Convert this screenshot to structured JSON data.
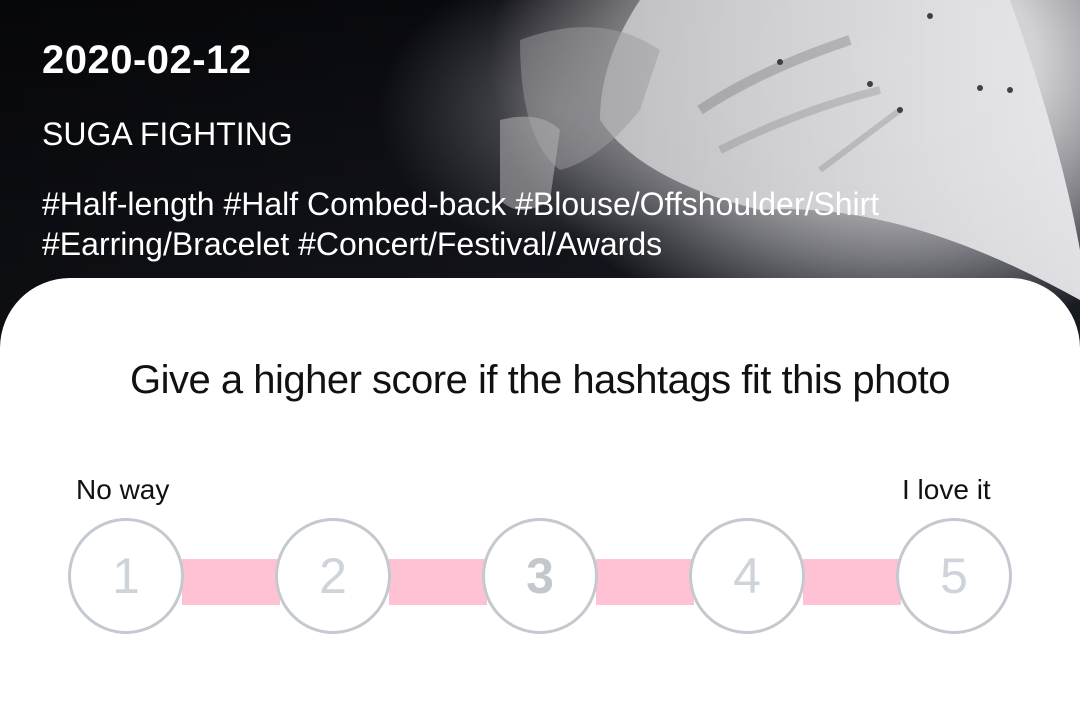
{
  "photo": {
    "date": "2020-02-12",
    "caption": "SUGA FIGHTING",
    "hashtags": [
      "#Half-length",
      "#Half Combed-back",
      "#Blouse/Offshoulder/Shirt",
      "#Earring/Bracelet",
      "#Concert/Festival/Awards"
    ]
  },
  "rating": {
    "prompt": "Give a higher score if the hashtags fit this photo",
    "low_label": "No way",
    "high_label": "I love it",
    "options": [
      "1",
      "2",
      "3",
      "4",
      "5"
    ],
    "connector_color": "#ffc2d4",
    "circle_border_color": "#c4c9d0"
  }
}
